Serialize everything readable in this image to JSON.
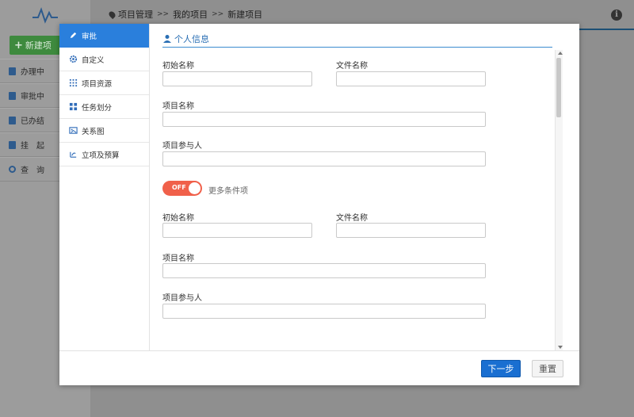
{
  "app": {
    "new_button": "新建项",
    "menu": [
      {
        "label": "办理中",
        "icon": "doc-icon"
      },
      {
        "label": "审批中",
        "icon": "edit-icon"
      },
      {
        "label": "已办结",
        "icon": "check-icon"
      },
      {
        "label": "挂　起",
        "icon": "pause-icon"
      },
      {
        "label": "查　询",
        "icon": "search-icon"
      }
    ],
    "breadcrumb": [
      "项目管理",
      "我的项目",
      "新建项目"
    ],
    "breadcrumb_sep": ">>"
  },
  "modal": {
    "nav": [
      {
        "label": "审批",
        "icon": "pen-icon",
        "active": true
      },
      {
        "label": "自定义",
        "icon": "gear-icon",
        "active": false
      },
      {
        "label": "项目资源",
        "icon": "grid-icon",
        "active": false
      },
      {
        "label": "任务划分",
        "icon": "tiles-icon",
        "active": false
      },
      {
        "label": "关系图",
        "icon": "diagram-icon",
        "active": false
      },
      {
        "label": "立项及预算",
        "icon": "budget-icon",
        "active": false
      }
    ],
    "section_title": "个人信息",
    "fields_top": {
      "initial_name": {
        "label": "初始名称",
        "value": ""
      },
      "file_name": {
        "label": "文件名称",
        "value": ""
      },
      "project_name": {
        "label": "项目名称",
        "value": ""
      },
      "participants": {
        "label": "项目参与人",
        "value": ""
      }
    },
    "toggle": {
      "state": "OFF",
      "text": "更多条件项"
    },
    "fields_bottom": {
      "initial_name": {
        "label": "初始名称",
        "value": ""
      },
      "file_name": {
        "label": "文件名称",
        "value": ""
      },
      "project_name": {
        "label": "项目名称",
        "value": ""
      },
      "participants": {
        "label": "项目参与人",
        "value": ""
      }
    },
    "footer": {
      "next": "下一步",
      "reset": "重置"
    }
  },
  "colors": {
    "accent": "#2a7fdc",
    "toggle_off": "#f0604a",
    "section": "#2a6fb4"
  }
}
